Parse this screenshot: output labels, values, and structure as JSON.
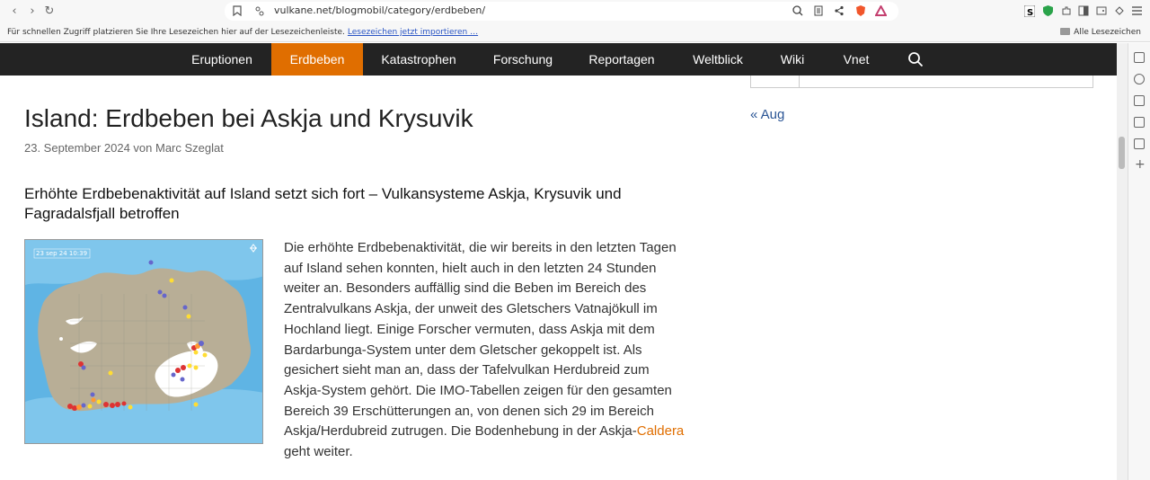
{
  "browser": {
    "url": "vulkane.net/blogmobil/category/erdbeben/",
    "bookmarks_hint": "Für schnellen Zugriff platzieren Sie Ihre Lesezeichen hier auf der Lesezeichenleiste.",
    "bookmarks_import": "Lesezeichen jetzt importieren …",
    "all_bookmarks": "Alle Lesezeichen"
  },
  "nav": {
    "items": [
      "Eruptionen",
      "Erdbeben",
      "Katastrophen",
      "Forschung",
      "Reportagen",
      "Weltblick",
      "Wiki",
      "Vnet"
    ],
    "active": "Erdbeben"
  },
  "article": {
    "title": "Island: Erdbeben bei Askja und Krysuvik",
    "meta": "23. September 2024 von Marc Szeglat",
    "subtitle": "Erhöhte Erdbebenaktivität auf Island setzt sich fort – Vulkansysteme Askja, Krysuvik und Fagradalsfjall betroffen",
    "map_timestamp": "23 sep 24  10:39",
    "body": "Die erhöhte Erdbebenaktivität, die wir bereits in den letzten Tagen auf Island sehen konnten, hielt auch in den letzten 24 Stunden weiter an. Besonders auffällig sind die Beben im Bereich des Zentralvulkans Askja, der unweit des Gletschers Vatnajökull im Hochland liegt. Einige Forscher vermuten, dass Askja mit dem Bardarbunga-System unter dem Gletscher gekoppelt ist. Als gesichert sieht man an, dass der Tafelvulkan Herdubreid zum Askja-System gehört. Die IMO-Tabellen zeigen für den gesamten Bereich 39 Erschütterungen an, von denen sich 29 im Bereich Askja/Herdubreid zutrugen. Die Bodenhebung in der Askja-",
    "body_link": "Caldera",
    "body_end": " geht weiter."
  },
  "sidebar": {
    "prev_link": "« Aug"
  },
  "colors": {
    "nav_bg": "#232323",
    "accent": "#e06e00",
    "link": "#2a5595"
  }
}
